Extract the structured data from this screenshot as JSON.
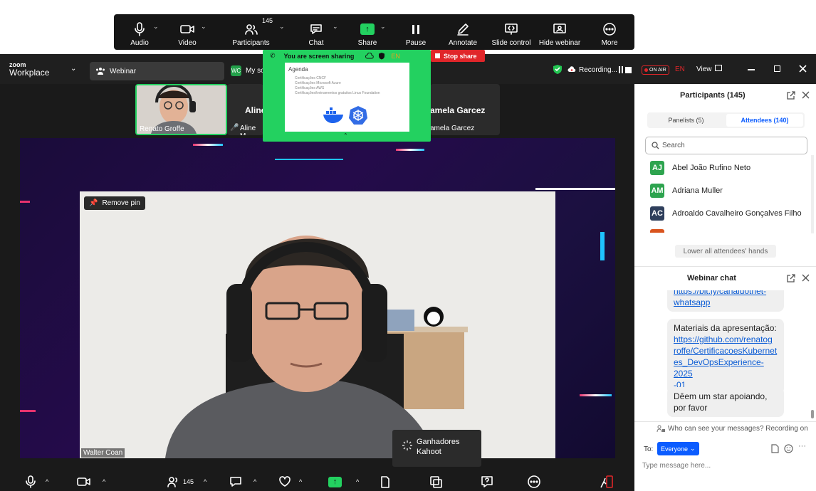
{
  "share_toolbar": {
    "audio": "Audio",
    "video": "Video",
    "participants": "Participants",
    "participants_count": "145",
    "chat": "Chat",
    "share": "Share",
    "pause": "Pause",
    "annotate": "Annotate",
    "slide_control": "Slide control",
    "hide_webinar": "Hide webinar",
    "more": "More"
  },
  "share_banner": {
    "text": "You are screen sharing",
    "lang": "EN",
    "stop_share": "Stop share"
  },
  "slide_preview": {
    "title": "Agenda",
    "bullets": [
      "Certificações CNCF",
      "Certificações Microsoft Azure",
      "Certificações AWS",
      "Certificações/treinamentos gratuitos Linux Foundation"
    ]
  },
  "titlebar": {
    "logo_top": "zoom",
    "logo_bottom": "Workplace",
    "tab_label": "Webinar",
    "avatar_initials": "WC",
    "meeting_name": "My so",
    "recording": "Recording...",
    "on_air": "ON AIR",
    "lang": "EN",
    "view": "View"
  },
  "gallery": {
    "tiles": [
      {
        "name": "Renato Groffe"
      },
      {
        "title": "Aline",
        "name": "Aline M"
      },
      {
        "title": "amela Garcez",
        "name": "amela Garcez"
      }
    ]
  },
  "stage": {
    "remove_pin": "Remove pin",
    "speaker_name": "Walter Coan"
  },
  "popup": {
    "line1": "Ganhadores",
    "line2": "Kahoot"
  },
  "bottom_toolbar": {
    "participants_count": "145"
  },
  "participants_panel": {
    "title": "Participants (145)",
    "tab_panelists": "Panelists (5)",
    "tab_attendees": "Attendees (140)",
    "search_placeholder": "Search",
    "attendees": [
      {
        "initials": "AJ",
        "name": "Abel João Rufino Neto",
        "color": "#2ea44f"
      },
      {
        "initials": "AM",
        "name": "Adriana Muller",
        "color": "#2ea44f"
      },
      {
        "initials": "AC",
        "name": "Adroaldo Cavalheiro Gonçalves Filho",
        "color": "#2f3f5c"
      }
    ],
    "lower_hands": "Lower all attendees' hands"
  },
  "chat_panel": {
    "title": "Webinar chat",
    "msg1_link_a": "https://bit.ly/canaldotnet-",
    "msg1_link_b": "whatsapp",
    "msg2_text": "Materiais da apresentação:",
    "msg2_link": [
      "https://github.com/renatog",
      "roffe/CertificacoesKubernet",
      "es_DevOpsExperience-2025",
      "-01"
    ],
    "msg3": [
      "Dêem um star apoiando,",
      "por favor"
    ],
    "privacy": "Who can see your messages? Recording on",
    "to_label": "To:",
    "to_value": "Everyone",
    "input_placeholder": "Type message here..."
  },
  "colors": {
    "accent_green": "#23d160",
    "stop_red": "#e0262a",
    "zoom_blue": "#0b5cff"
  }
}
